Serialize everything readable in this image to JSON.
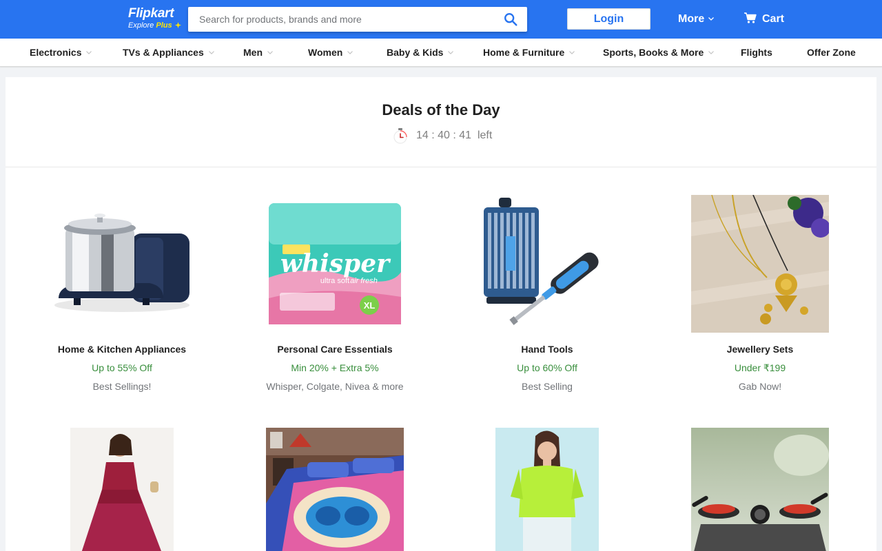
{
  "header": {
    "logo_main": "Flipkart",
    "logo_sub_prefix": "Explore",
    "logo_sub_plus": "Plus",
    "search_placeholder": "Search for products, brands and more",
    "login_label": "Login",
    "more_label": "More",
    "cart_label": "Cart",
    "colors": {
      "brand_blue": "#2874f0",
      "plus_yellow": "#ffe500"
    }
  },
  "categories": [
    {
      "label": "Electronics",
      "dropdown": true
    },
    {
      "label": "TVs & Appliances",
      "dropdown": true
    },
    {
      "label": "Men",
      "dropdown": true
    },
    {
      "label": "Women",
      "dropdown": true
    },
    {
      "label": "Baby & Kids",
      "dropdown": true
    },
    {
      "label": "Home & Furniture",
      "dropdown": true
    },
    {
      "label": "Sports, Books & More",
      "dropdown": true
    },
    {
      "label": "Flights",
      "dropdown": false
    },
    {
      "label": "Offer Zone",
      "dropdown": false
    }
  ],
  "deals": {
    "title": "Deals of the Day",
    "timer": {
      "hours": "14",
      "minutes": "40",
      "seconds": "41",
      "suffix": "left"
    },
    "products": [
      {
        "name": "Home & Kitchen Appliances",
        "offer": "Up to 55% Off",
        "subtitle": "Best Sellings!",
        "image": "wet-grinder-image"
      },
      {
        "name": "Personal Care Essentials",
        "offer": "Min 20% + Extra 5%",
        "subtitle": "Whisper, Colgate, Nivea & more",
        "image": "whisper-pack-image",
        "image_text": {
          "brand": "whisper",
          "line1": "ultra soft",
          "line2": "air fresh",
          "badge": "XL"
        }
      },
      {
        "name": "Hand Tools",
        "offer": "Up to 60% Off",
        "subtitle": "Best Selling",
        "image": "screwdriver-set-image"
      },
      {
        "name": "Jewellery Sets",
        "offer": "Under ₹199",
        "subtitle": "Gab Now!",
        "image": "jewellery-set-image"
      },
      {
        "name": "",
        "offer": "",
        "subtitle": "",
        "image": "ethnic-dress-image"
      },
      {
        "name": "",
        "offer": "",
        "subtitle": "",
        "image": "bedsheet-image"
      },
      {
        "name": "",
        "offer": "",
        "subtitle": "",
        "image": "green-top-image"
      },
      {
        "name": "",
        "offer": "",
        "subtitle": "",
        "image": "gas-stove-image"
      }
    ],
    "colors": {
      "offer_green": "#388e3c",
      "subtitle_grey": "#717478"
    }
  }
}
